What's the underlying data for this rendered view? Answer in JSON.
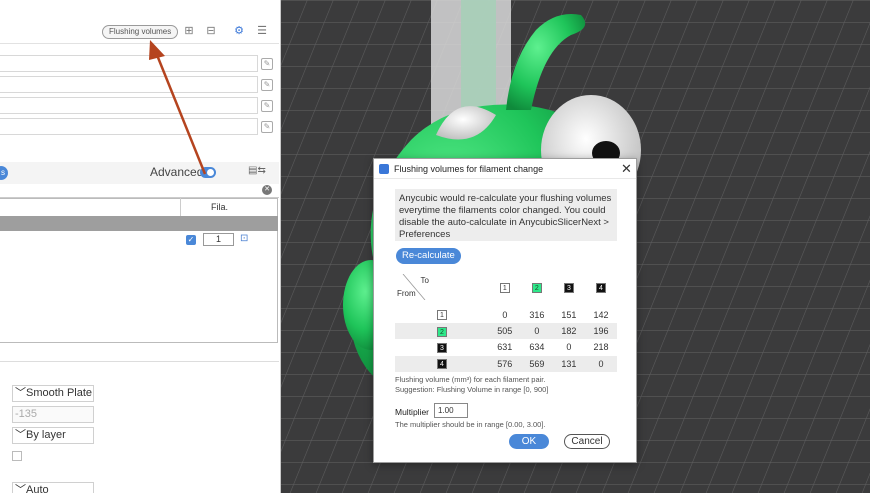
{
  "toolbar": {
    "flushing_volumes_label": "Flushing volumes",
    "icons": [
      "add-filament-icon",
      "remove-filament-icon",
      "filament-settings-icon",
      "filament-adjust-icon"
    ]
  },
  "process": {
    "advanced_label": "Advanced",
    "advanced_on": true,
    "table_header_fila": "Fila.",
    "row_value": "1"
  },
  "plate_settings": {
    "plate_type": "Smooth Plate",
    "value_field": "-135",
    "sequence": "By layer",
    "auto_label": "Auto"
  },
  "dialog": {
    "title": "Flushing volumes for filament change",
    "info": "Anycubic would re-calculate your flushing volumes everytime the filaments color changed. You could disable the auto-calculate in AnycubicSlicerNext > Preferences",
    "recalculate_label": "Re-calculate",
    "to_label": "To",
    "from_label": "From",
    "filaments": [
      {
        "id": "1",
        "color": "#ffffff",
        "text_color": "#333333"
      },
      {
        "id": "2",
        "color": "#2ee88a",
        "text_color": "#1a4a2a"
      },
      {
        "id": "3",
        "color": "#111111",
        "text_color": "#ffffff"
      },
      {
        "id": "4",
        "color": "#111111",
        "text_color": "#ffffff"
      }
    ],
    "matrix": [
      [
        "0",
        "316",
        "151",
        "142"
      ],
      [
        "505",
        "0",
        "182",
        "196"
      ],
      [
        "631",
        "634",
        "0",
        "218"
      ],
      [
        "576",
        "569",
        "131",
        "0"
      ]
    ],
    "note_flushing": "Flushing volume (mm³) for each filament pair.",
    "note_suggestion": "Suggestion: Flushing Volume in range [0, 900]",
    "multiplier_label": "Multiplier",
    "multiplier_value": "1.00",
    "multiplier_range": "The multiplier should be in range [0.00, 3.00].",
    "ok_label": "OK",
    "cancel_label": "Cancel"
  },
  "colors": {
    "accent": "#4a88d8",
    "model_green": "#22c55e",
    "annotation_arrow": "#b5441f"
  }
}
